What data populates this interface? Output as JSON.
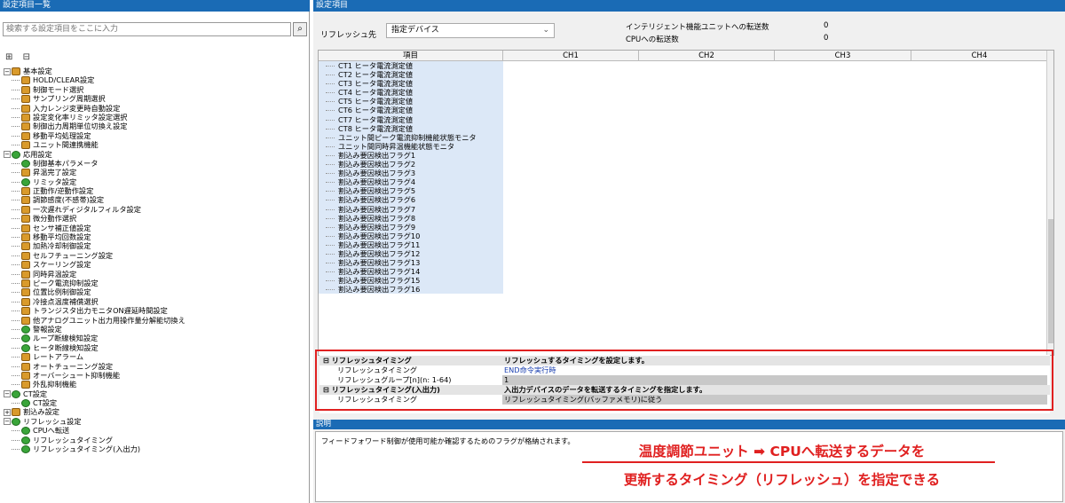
{
  "left_pane": {
    "title": "設定項目一覧",
    "search_placeholder": "検索する設定項目をここに入力",
    "search_icon": "binoculars-icon",
    "tree": [
      {
        "label": "基本設定",
        "level": 1,
        "icon": "orange",
        "expanded": true
      },
      {
        "label": "HOLD/CLEAR設定",
        "level": 2,
        "icon": "orange"
      },
      {
        "label": "制御モード選択",
        "level": 2,
        "icon": "orange"
      },
      {
        "label": "サンプリング周期選択",
        "level": 2,
        "icon": "orange"
      },
      {
        "label": "入力レンジ変更時自動設定",
        "level": 2,
        "icon": "orange"
      },
      {
        "label": "設定変化率リミッタ設定選択",
        "level": 2,
        "icon": "orange"
      },
      {
        "label": "制御出力周期単位切換え設定",
        "level": 2,
        "icon": "orange"
      },
      {
        "label": "移動平均処理設定",
        "level": 2,
        "icon": "orange"
      },
      {
        "label": "ユニット間連携機能",
        "level": 2,
        "icon": "orange"
      },
      {
        "label": "応用設定",
        "level": 1,
        "icon": "green",
        "expanded": true
      },
      {
        "label": "制御基本パラメータ",
        "level": 2,
        "icon": "green"
      },
      {
        "label": "昇温完了設定",
        "level": 2,
        "icon": "orange"
      },
      {
        "label": "リミッタ設定",
        "level": 2,
        "icon": "green"
      },
      {
        "label": "正動作/逆動作設定",
        "level": 2,
        "icon": "orange"
      },
      {
        "label": "調節感度(不感帯)設定",
        "level": 2,
        "icon": "orange"
      },
      {
        "label": "一次遅れディジタルフィルタ設定",
        "level": 2,
        "icon": "orange"
      },
      {
        "label": "微分動作選択",
        "level": 2,
        "icon": "orange"
      },
      {
        "label": "センサ補正値設定",
        "level": 2,
        "icon": "orange"
      },
      {
        "label": "移動平均回数設定",
        "level": 2,
        "icon": "orange"
      },
      {
        "label": "加熱冷却制御設定",
        "level": 2,
        "icon": "orange"
      },
      {
        "label": "セルフチューニング設定",
        "level": 2,
        "icon": "orange"
      },
      {
        "label": "スケーリング設定",
        "level": 2,
        "icon": "orange"
      },
      {
        "label": "同時昇温設定",
        "level": 2,
        "icon": "orange"
      },
      {
        "label": "ピーク電流抑制設定",
        "level": 2,
        "icon": "orange"
      },
      {
        "label": "位置比例制御設定",
        "level": 2,
        "icon": "orange"
      },
      {
        "label": "冷接点温度補償選択",
        "level": 2,
        "icon": "orange"
      },
      {
        "label": "トランジスタ出力モニタON遅延時間設定",
        "level": 2,
        "icon": "orange"
      },
      {
        "label": "他アナログユニット出力用操作量分解能切換え",
        "level": 2,
        "icon": "orange"
      },
      {
        "label": "警報設定",
        "level": 2,
        "icon": "green"
      },
      {
        "label": "ループ断線検知設定",
        "level": 2,
        "icon": "green"
      },
      {
        "label": "ヒータ断線検知設定",
        "level": 2,
        "icon": "green"
      },
      {
        "label": "レートアラーム",
        "level": 2,
        "icon": "orange"
      },
      {
        "label": "オートチューニング設定",
        "level": 2,
        "icon": "orange"
      },
      {
        "label": "オーバーシュート抑制機能",
        "level": 2,
        "icon": "orange"
      },
      {
        "label": "外乱抑制機能",
        "level": 2,
        "icon": "orange"
      },
      {
        "label": "CT設定",
        "level": 1,
        "icon": "green",
        "expanded": true
      },
      {
        "label": "CT設定",
        "level": 2,
        "icon": "green"
      },
      {
        "label": "割込み設定",
        "level": 1,
        "icon": "orange",
        "expanded": false
      },
      {
        "label": "リフレッシュ設定",
        "level": 1,
        "icon": "green",
        "expanded": true
      },
      {
        "label": "CPUへ転送",
        "level": 2,
        "icon": "green"
      },
      {
        "label": "リフレッシュタイミング",
        "level": 2,
        "icon": "green"
      },
      {
        "label": "リフレッシュタイミング(入出力)",
        "level": 2,
        "icon": "green"
      }
    ]
  },
  "right_pane": {
    "title": "設定項目",
    "refresh_label": "リフレッシュ先",
    "refresh_value": "指定デバイス",
    "transfer_intelligent_label": "インテリジェント機能ユニットへの転送数",
    "transfer_intelligent_value": "0",
    "transfer_cpu_label": "CPUへの転送数",
    "transfer_cpu_value": "0",
    "grid_headers": [
      "項目",
      "CH1",
      "CH2",
      "CH3",
      "CH4"
    ],
    "grid_rows": [
      "CT1 ヒータ電流測定値",
      "CT2 ヒータ電流測定値",
      "CT3 ヒータ電流測定値",
      "CT4 ヒータ電流測定値",
      "CT5 ヒータ電流測定値",
      "CT6 ヒータ電流測定値",
      "CT7 ヒータ電流測定値",
      "CT8 ヒータ電流測定値",
      "ユニット間ピーク電流抑制機能状態モニタ",
      "ユニット間同時昇温機能状態モニタ",
      "割込み要因検出フラグ1",
      "割込み要因検出フラグ2",
      "割込み要因検出フラグ3",
      "割込み要因検出フラグ4",
      "割込み要因検出フラグ5",
      "割込み要因検出フラグ6",
      "割込み要因検出フラグ7",
      "割込み要因検出フラグ8",
      "割込み要因検出フラグ9",
      "割込み要因検出フラグ10",
      "割込み要因検出フラグ11",
      "割込み要因検出フラグ12",
      "割込み要因検出フラグ13",
      "割込み要因検出フラグ14",
      "割込み要因検出フラグ15",
      "割込み要因検出フラグ16"
    ],
    "props": {
      "group1_label": "リフレッシュタイミング",
      "group1_desc": "リフレッシュするタイミングを設定します。",
      "timing_label": "リフレッシュタイミング",
      "timing_value": "END命令実行時",
      "group_label": "リフレッシュグループ[n](n: 1-64)",
      "group_value": "1",
      "group2_label": "リフレッシュタイミング(入出力)",
      "group2_desc": "入出力デバイスのデータを転送するタイミングを指定します。",
      "timing2_label": "リフレッシュタイミング",
      "timing2_value": "リフレッシュタイミング(バッファメモリ)に従う"
    },
    "desc_title": "説明",
    "desc_text": "フィードフォワード制御が使用可能か確認するためのフラグが格納されます。"
  },
  "callout": {
    "line1": "温度調節ユニット ➡ CPUへ転送するデータを",
    "line2": "更新するタイミング（リフレッシュ）を指定できる"
  },
  "colors": {
    "accent": "#1a6bb5",
    "highlight": "#e02020",
    "item_column": "#dce8f7"
  }
}
